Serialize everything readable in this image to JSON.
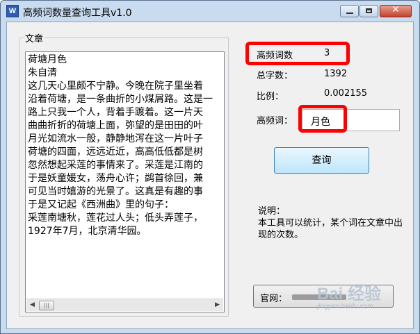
{
  "window": {
    "title": "高频词数量查询工具v1.0",
    "app_icon": "W"
  },
  "article": {
    "group_label": "文章",
    "text": "荷塘月色\n朱自清\n这几天心里颇不宁静。今晚在院子里坐着\n沿着荷塘，是一条曲折的小煤屑路。这是一\n路上只我一个人，背着手踱着。这一片天\n曲曲折折的荷塘上面，弥望的是田田的叶\n月光如流水一般，静静地泻在这一片叶子\n荷塘的四面，远远近近，高高低低都是树\n忽然想起采莲的事情来了。采莲是江南的\n于是妖童媛女，荡舟心许；鹢首徐回，兼\n可见当时嬉游的光景了。这真是有趣的事\n于是又记起《西洲曲》里的句子：\n采莲南塘秋，莲花过人头；低头弄莲子，\n1927年7月，北京清华园。"
  },
  "stats": {
    "high_freq_label": "高频词数",
    "high_freq_value": "3",
    "total_chars_label": "总字数：",
    "total_chars_value": "1392",
    "ratio_label": "比例：",
    "ratio_value": "0.002155",
    "word_label": "高频词：",
    "word_value": "月色"
  },
  "query_button": "查询",
  "description": {
    "title": "说明：",
    "body": "本工具可以统计，某个词在文章中出现的次数。"
  },
  "website_label": "官网：",
  "watermark": {
    "text": "Bai 经验",
    "subtext": "jingyan.baidu.com"
  },
  "colors": {
    "highlight": "#ff0000",
    "title_bar": "#c9dbef",
    "query_button": "#bee6fd"
  }
}
